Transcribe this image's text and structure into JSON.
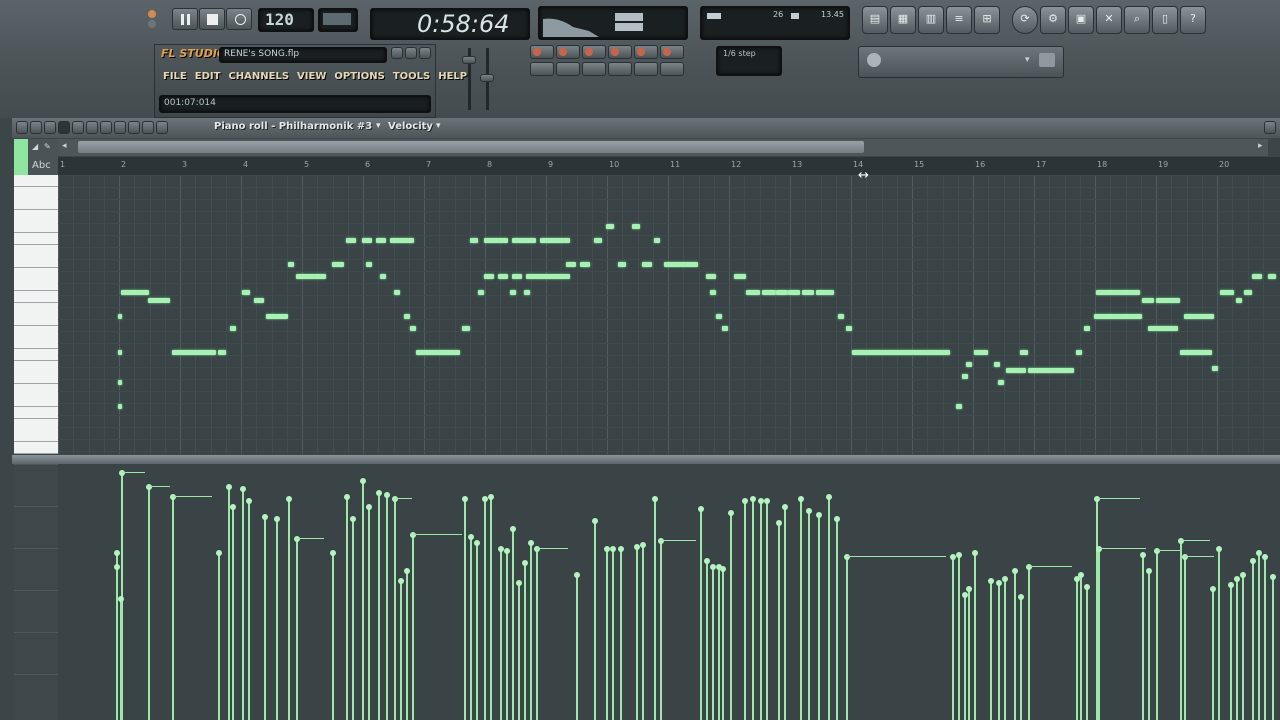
{
  "toolbar": {
    "tempo": "120",
    "time": "0:58:64",
    "logo": "FL STUDIO",
    "song_file": "RENE's SONG.flp",
    "position": "001:07:014",
    "snap_label": "1/6 step",
    "menu": [
      "FILE",
      "EDIT",
      "CHANNELS",
      "VIEW",
      "OPTIONS",
      "TOOLS",
      "HELP"
    ],
    "monitor": {
      "left_value": "26",
      "right_value": "13.45"
    }
  },
  "piano_roll": {
    "title": "Piano roll - Philharmonik #3",
    "target": "Velocity",
    "ruler_marks": [
      "1",
      "2",
      "3",
      "4",
      "5",
      "6",
      "7",
      "8",
      "9",
      "10",
      "11",
      "12",
      "13",
      "14",
      "15",
      "16",
      "17",
      "18",
      "19",
      "20"
    ],
    "abc_label": "Abc"
  },
  "colors": {
    "note": "#a8f0b4",
    "grid": "#3a4447",
    "toolbar": "#4a5256",
    "lcd": "#1a1f21"
  }
}
